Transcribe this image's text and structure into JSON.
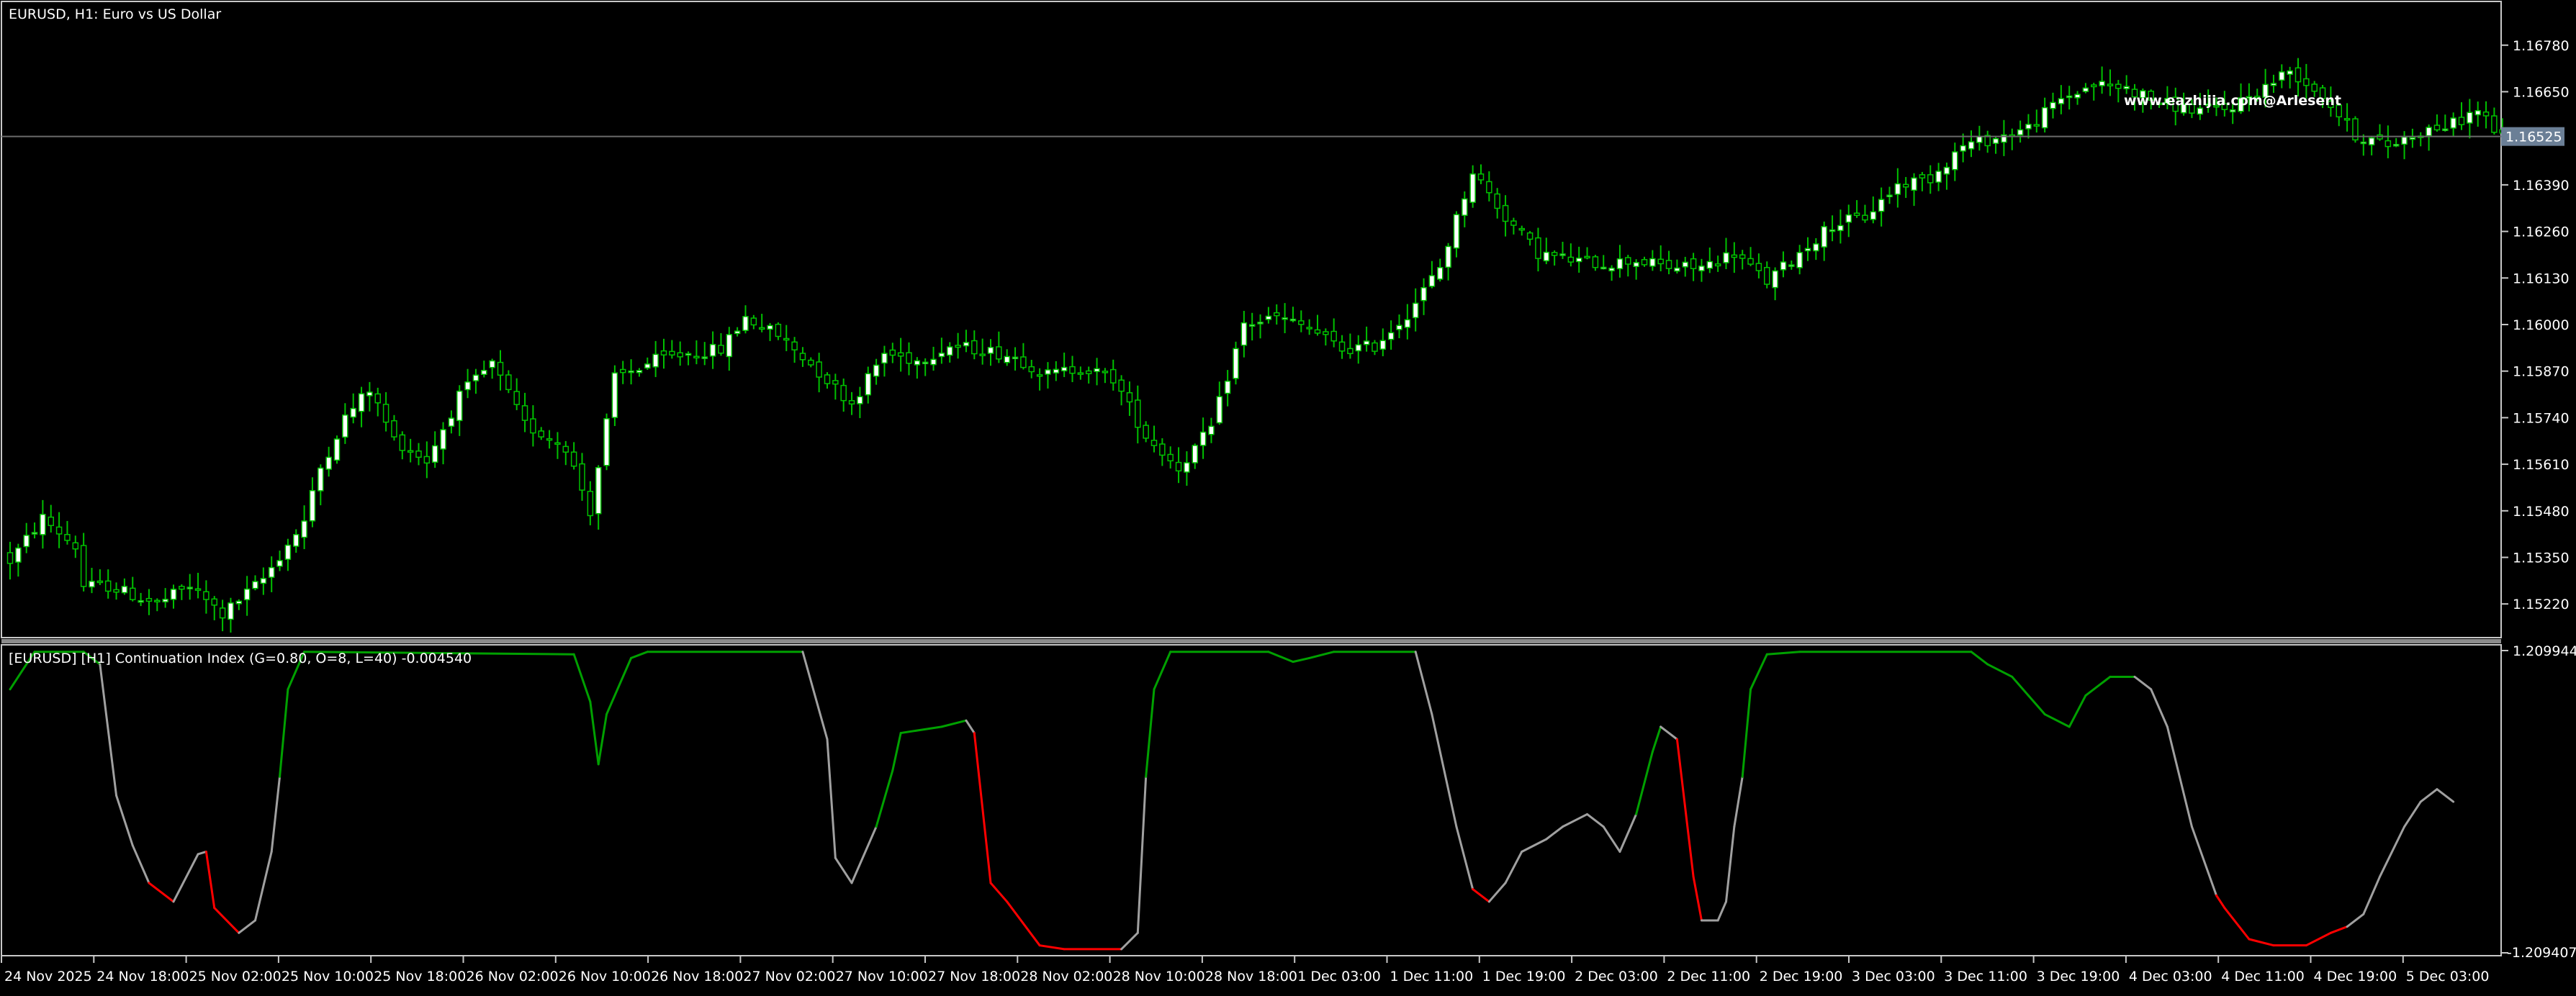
{
  "colors": {
    "background": "#000000",
    "frame": "#c8c8c8",
    "bull_candle": "#ffffff",
    "bear_candle": "#000000",
    "candle_outline": "#00c000",
    "wick": "#00c000",
    "hline": "#6a6a6a",
    "price_tag_bg": "#6b7f96",
    "separator": "#8c8c8c",
    "ind_green": "#00a000",
    "ind_grey": "#a0a0a0",
    "ind_red": "#ff0000"
  },
  "main_chart": {
    "title": "EURUSD, H1:  Euro vs US Dollar",
    "watermark": "www.eazhijia.com@Arlesent",
    "current_price": "1.16525",
    "y_ticks": [
      "1.16780",
      "1.16650",
      "1.16390",
      "1.16260",
      "1.16130",
      "1.16000",
      "1.15870",
      "1.15740",
      "1.15610",
      "1.15480",
      "1.15350",
      "1.15220"
    ]
  },
  "indicator": {
    "title": "[EURUSD] [H1] Continuation Index (G=0.80, O=8, L=40) -0.004540",
    "y_max_label": "1.209944",
    "y_min_label": "-1.209407"
  },
  "x_labels": [
    "24 Nov 2025",
    "24 Nov 18:00",
    "25 Nov 02:00",
    "25 Nov 10:00",
    "25 Nov 18:00",
    "26 Nov 02:00",
    "26 Nov 10:00",
    "26 Nov 18:00",
    "27 Nov 02:00",
    "27 Nov 10:00",
    "27 Nov 18:00",
    "28 Nov 02:00",
    "28 Nov 10:00",
    "28 Nov 18:00",
    "1 Dec 03:00",
    "1 Dec 11:00",
    "1 Dec 19:00",
    "2 Dec 03:00",
    "2 Dec 11:00",
    "2 Dec 19:00",
    "3 Dec 03:00",
    "3 Dec 11:00",
    "3 Dec 19:00",
    "4 Dec 03:00",
    "4 Dec 11:00",
    "4 Dec 19:00",
    "5 Dec 03:00"
  ],
  "chart_data": [
    {
      "type": "candlestick",
      "title": "EURUSD, H1:  Euro vs US Dollar",
      "ylim": [
        1.1513,
        1.1689
      ],
      "close_path": [
        [
          0,
          1.1534
        ],
        [
          4,
          1.1546
        ],
        [
          8,
          1.1538
        ],
        [
          9,
          1.1527
        ],
        [
          12,
          1.1527
        ],
        [
          18,
          1.1522
        ],
        [
          22,
          1.1527
        ],
        [
          26,
          1.1519
        ],
        [
          31,
          1.1529
        ],
        [
          36,
          1.1545
        ],
        [
          38,
          1.156
        ],
        [
          41,
          1.1574
        ],
        [
          44,
          1.1582
        ],
        [
          47,
          1.1568
        ],
        [
          51,
          1.1562
        ],
        [
          55,
          1.158
        ],
        [
          59,
          1.1589
        ],
        [
          63,
          1.1572
        ],
        [
          68,
          1.1566
        ],
        [
          71,
          1.1548
        ],
        [
          74,
          1.1585
        ],
        [
          79,
          1.159
        ],
        [
          83,
          1.1592
        ],
        [
          87,
          1.1593
        ],
        [
          90,
          1.1602
        ],
        [
          94,
          1.1597
        ],
        [
          98,
          1.1589
        ],
        [
          103,
          1.1578
        ],
        [
          107,
          1.1592
        ],
        [
          111,
          1.159
        ],
        [
          115,
          1.1594
        ],
        [
          119,
          1.1593
        ],
        [
          123,
          1.1591
        ],
        [
          127,
          1.1586
        ],
        [
          131,
          1.1588
        ],
        [
          135,
          1.1585
        ],
        [
          139,
          1.1569
        ],
        [
          143,
          1.156
        ],
        [
          147,
          1.1571
        ],
        [
          151,
          1.16
        ],
        [
          155,
          1.1602
        ],
        [
          159,
          1.1599
        ],
        [
          163,
          1.1593
        ],
        [
          167,
          1.1594
        ],
        [
          171,
          1.1603
        ],
        [
          175,
          1.1616
        ],
        [
          179,
          1.1643
        ],
        [
          183,
          1.163
        ],
        [
          187,
          1.162
        ],
        [
          191,
          1.1618
        ],
        [
          195,
          1.1617
        ],
        [
          199,
          1.1618
        ],
        [
          203,
          1.1616
        ],
        [
          207,
          1.1616
        ],
        [
          211,
          1.162
        ],
        [
          215,
          1.1612
        ],
        [
          219,
          1.162
        ],
        [
          223,
          1.1628
        ],
        [
          227,
          1.163
        ],
        [
          231,
          1.1639
        ],
        [
          235,
          1.1641
        ],
        [
          239,
          1.165
        ],
        [
          243,
          1.1652
        ],
        [
          247,
          1.1655
        ],
        [
          251,
          1.1663
        ],
        [
          255,
          1.1667
        ],
        [
          259,
          1.1666
        ],
        [
          263,
          1.1662
        ],
        [
          267,
          1.166
        ],
        [
          271,
          1.166
        ],
        [
          275,
          1.1665
        ],
        [
          279,
          1.1671
        ],
        [
          283,
          1.1664
        ],
        [
          287,
          1.1653
        ],
        [
          291,
          1.165
        ],
        [
          295,
          1.1654
        ],
        [
          299,
          1.1656
        ],
        [
          302,
          1.166
        ],
        [
          305,
          1.1652
        ]
      ]
    },
    {
      "type": "line",
      "title": "[EURUSD] [H1] Continuation Index (G=0.80, O=8, L=40) -0.004540",
      "ylim": [
        -1.209407,
        1.209944
      ],
      "points": [
        [
          0,
          0.9,
          "g"
        ],
        [
          3,
          1.2,
          "g"
        ],
        [
          9,
          1.2,
          "g"
        ],
        [
          11,
          1.1,
          "g"
        ],
        [
          13,
          0.05,
          "x"
        ],
        [
          15,
          -0.35,
          "x"
        ],
        [
          17,
          -0.65,
          "x"
        ],
        [
          20,
          -0.8,
          "r"
        ],
        [
          23,
          -0.42,
          "x"
        ],
        [
          24,
          -0.4,
          "x"
        ],
        [
          25,
          -0.85,
          "r"
        ],
        [
          28,
          -1.05,
          "r"
        ],
        [
          30,
          -0.95,
          "x"
        ],
        [
          32,
          -0.4,
          "x"
        ],
        [
          33,
          0.2,
          "x"
        ],
        [
          34,
          0.9,
          "g"
        ],
        [
          36,
          1.2,
          "g"
        ],
        [
          69,
          1.18,
          "g"
        ],
        [
          71,
          0.8,
          "g"
        ],
        [
          72,
          0.3,
          "g"
        ],
        [
          73,
          0.7,
          "g"
        ],
        [
          76,
          1.15,
          "g"
        ],
        [
          78,
          1.2,
          "g"
        ],
        [
          97,
          1.2,
          "g"
        ],
        [
          100,
          0.5,
          "x"
        ],
        [
          101,
          -0.45,
          "x"
        ],
        [
          103,
          -0.65,
          "x"
        ],
        [
          106,
          -0.2,
          "x"
        ],
        [
          108,
          0.25,
          "g"
        ],
        [
          109,
          0.55,
          "g"
        ],
        [
          114,
          0.6,
          "g"
        ],
        [
          117,
          0.65,
          "g"
        ],
        [
          118,
          0.55,
          "x"
        ],
        [
          120,
          -0.65,
          "r"
        ],
        [
          122,
          -0.8,
          "r"
        ],
        [
          126,
          -1.15,
          "r"
        ],
        [
          129,
          -1.18,
          "r"
        ],
        [
          136,
          -1.18,
          "r"
        ],
        [
          138,
          -1.05,
          "x"
        ],
        [
          139,
          0.2,
          "x"
        ],
        [
          140,
          0.9,
          "g"
        ],
        [
          142,
          1.2,
          "g"
        ],
        [
          154,
          1.2,
          "g"
        ],
        [
          157,
          1.12,
          "g"
        ],
        [
          159,
          1.15,
          "g"
        ],
        [
          162,
          1.2,
          "g"
        ],
        [
          172,
          1.2,
          "g"
        ],
        [
          174,
          0.7,
          "x"
        ],
        [
          177,
          -0.2,
          "x"
        ],
        [
          179,
          -0.7,
          "x"
        ],
        [
          181,
          -0.8,
          "r"
        ],
        [
          183,
          -0.65,
          "x"
        ],
        [
          185,
          -0.4,
          "x"
        ],
        [
          188,
          -0.3,
          "x"
        ],
        [
          190,
          -0.2,
          "x"
        ],
        [
          193,
          -0.1,
          "x"
        ],
        [
          195,
          -0.2,
          "x"
        ],
        [
          197,
          -0.4,
          "x"
        ],
        [
          199,
          -0.1,
          "x"
        ],
        [
          201,
          0.4,
          "g"
        ],
        [
          202,
          0.6,
          "g"
        ],
        [
          204,
          0.5,
          "x"
        ],
        [
          206,
          -0.6,
          "r"
        ],
        [
          207,
          -0.95,
          "r"
        ],
        [
          209,
          -0.95,
          "x"
        ],
        [
          210,
          -0.8,
          "x"
        ],
        [
          211,
          -0.2,
          "x"
        ],
        [
          212,
          0.2,
          "x"
        ],
        [
          213,
          0.9,
          "g"
        ],
        [
          215,
          1.18,
          "g"
        ],
        [
          219,
          1.2,
          "g"
        ],
        [
          240,
          1.2,
          "g"
        ],
        [
          242,
          1.1,
          "g"
        ],
        [
          245,
          1.0,
          "g"
        ],
        [
          247,
          0.85,
          "g"
        ],
        [
          249,
          0.7,
          "g"
        ],
        [
          252,
          0.6,
          "g"
        ],
        [
          254,
          0.85,
          "g"
        ],
        [
          257,
          1.0,
          "g"
        ],
        [
          260,
          1.0,
          "g"
        ],
        [
          262,
          0.9,
          "x"
        ],
        [
          264,
          0.6,
          "x"
        ],
        [
          267,
          -0.2,
          "x"
        ],
        [
          270,
          -0.75,
          "x"
        ],
        [
          271,
          -0.85,
          "r"
        ],
        [
          274,
          -1.1,
          "r"
        ],
        [
          277,
          -1.15,
          "r"
        ],
        [
          281,
          -1.15,
          "r"
        ],
        [
          284,
          -1.05,
          "r"
        ],
        [
          286,
          -1.0,
          "r"
        ],
        [
          288,
          -0.9,
          "x"
        ],
        [
          290,
          -0.6,
          "x"
        ],
        [
          293,
          -0.2,
          "x"
        ],
        [
          295,
          0.0,
          "x"
        ],
        [
          297,
          0.1,
          "x"
        ],
        [
          299,
          0.0,
          "x"
        ]
      ]
    }
  ]
}
